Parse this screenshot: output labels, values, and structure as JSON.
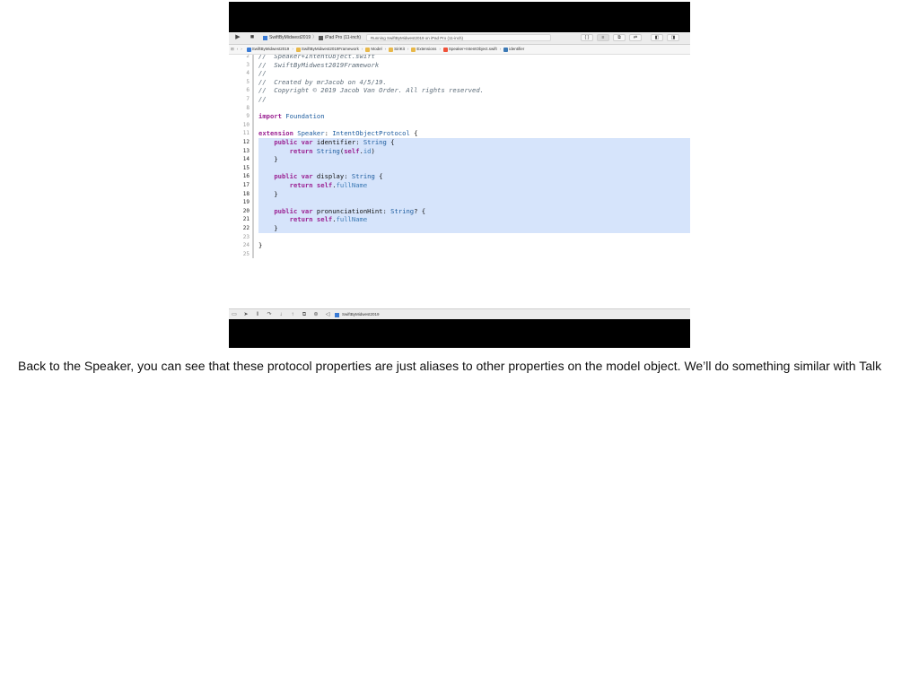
{
  "toolbar": {
    "scheme_target": "SwiftByMidwest2019",
    "scheme_device": "iPad Pro (11-inch)",
    "status_text": "Running SwiftByMidwest2019 on iPad Pro (11-inch)",
    "run_icon": "play-icon",
    "stop_icon": "stop-icon"
  },
  "jumpbar": {
    "items": [
      {
        "label": "SwiftByMidwest2019",
        "icon": "project-icon",
        "color": "#3a7bd5"
      },
      {
        "label": "SwiftByMidwest2019Framework",
        "icon": "folder-icon",
        "color": "#e8b84a"
      },
      {
        "label": "Model",
        "icon": "folder-icon",
        "color": "#e8b84a"
      },
      {
        "label": "SiriKit",
        "icon": "folder-icon",
        "color": "#e8b84a"
      },
      {
        "label": "Extensions",
        "icon": "folder-icon",
        "color": "#e8b84a"
      },
      {
        "label": "Speaker+IntentObject.swift",
        "icon": "swift-file-icon",
        "color": "#f05138"
      },
      {
        "label": "identifier",
        "icon": "property-icon",
        "color": "#3b79b5"
      }
    ]
  },
  "editor": {
    "lines": [
      {
        "num": "2",
        "text": "//  Speaker+IntentObject.swift",
        "kind": "comment",
        "sel": false
      },
      {
        "num": "3",
        "text": "//  SwiftByMidwest2019Framework",
        "kind": "comment",
        "sel": false
      },
      {
        "num": "4",
        "text": "//",
        "kind": "comment",
        "sel": false
      },
      {
        "num": "5",
        "text": "//  Created by mrJacob on 4/5/19.",
        "kind": "comment",
        "sel": false
      },
      {
        "num": "6",
        "text": "//  Copyright © 2019 Jacob Van Order. All rights reserved.",
        "kind": "comment",
        "sel": false
      },
      {
        "num": "7",
        "text": "//",
        "kind": "comment",
        "sel": false
      },
      {
        "num": "8",
        "text": "",
        "kind": "plain",
        "sel": false
      },
      {
        "num": "9",
        "text": "import Foundation",
        "kind": "import",
        "sel": false
      },
      {
        "num": "10",
        "text": "",
        "kind": "plain",
        "sel": false
      },
      {
        "num": "11",
        "text": "extension Speaker: IntentObjectProtocol {",
        "kind": "ext",
        "sel": false
      },
      {
        "num": "12",
        "text": "    public var identifier: String {",
        "kind": "var",
        "sel": true
      },
      {
        "num": "13",
        "text": "        return String(self.id)",
        "kind": "ret1",
        "sel": true
      },
      {
        "num": "14",
        "text": "    }",
        "kind": "plain",
        "sel": true
      },
      {
        "num": "15",
        "text": "",
        "kind": "plain",
        "sel": true
      },
      {
        "num": "16",
        "text": "    public var display: String {",
        "kind": "var",
        "sel": true
      },
      {
        "num": "17",
        "text": "        return self.fullName",
        "kind": "ret2",
        "sel": true
      },
      {
        "num": "18",
        "text": "    }",
        "kind": "plain",
        "sel": true
      },
      {
        "num": "19",
        "text": "",
        "kind": "plain",
        "sel": true
      },
      {
        "num": "20",
        "text": "    public var pronunciationHint: String? {",
        "kind": "var",
        "sel": true
      },
      {
        "num": "21",
        "text": "        return self.fullName",
        "kind": "ret2",
        "sel": true
      },
      {
        "num": "22",
        "text": "    }",
        "kind": "plain",
        "sel": true
      },
      {
        "num": "23",
        "text": "",
        "kind": "plain",
        "sel": false
      },
      {
        "num": "24",
        "text": "}",
        "kind": "plain",
        "sel": false
      },
      {
        "num": "25",
        "text": "",
        "kind": "plain",
        "sel": false
      }
    ]
  },
  "bottombar": {
    "target_label": "SwiftByMidwest2019"
  },
  "caption": "Back to the Speaker, you can see that these protocol properties are just aliases to other properties on the model object. We’ll do something similar with Talk",
  "colors": {
    "selection": "#d6e4fb",
    "keyword": "#9b2393",
    "type": "#1c5b9e",
    "comment": "#5d6c79"
  }
}
